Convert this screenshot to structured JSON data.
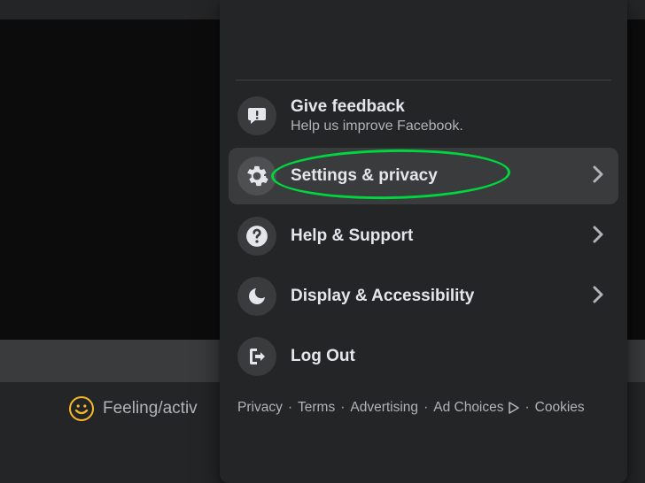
{
  "composer": {
    "feeling_label": "Feeling/activ"
  },
  "menu": {
    "feedback": {
      "title": "Give feedback",
      "subtitle": "Help us improve Facebook."
    },
    "settings": {
      "title": "Settings & privacy"
    },
    "help": {
      "title": "Help & Support"
    },
    "display": {
      "title": "Display & Accessibility"
    },
    "logout": {
      "title": "Log Out"
    }
  },
  "footer": {
    "privacy": "Privacy",
    "terms": "Terms",
    "advertising": "Advertising",
    "adchoices": "Ad Choices",
    "cookies": "Cookies"
  }
}
